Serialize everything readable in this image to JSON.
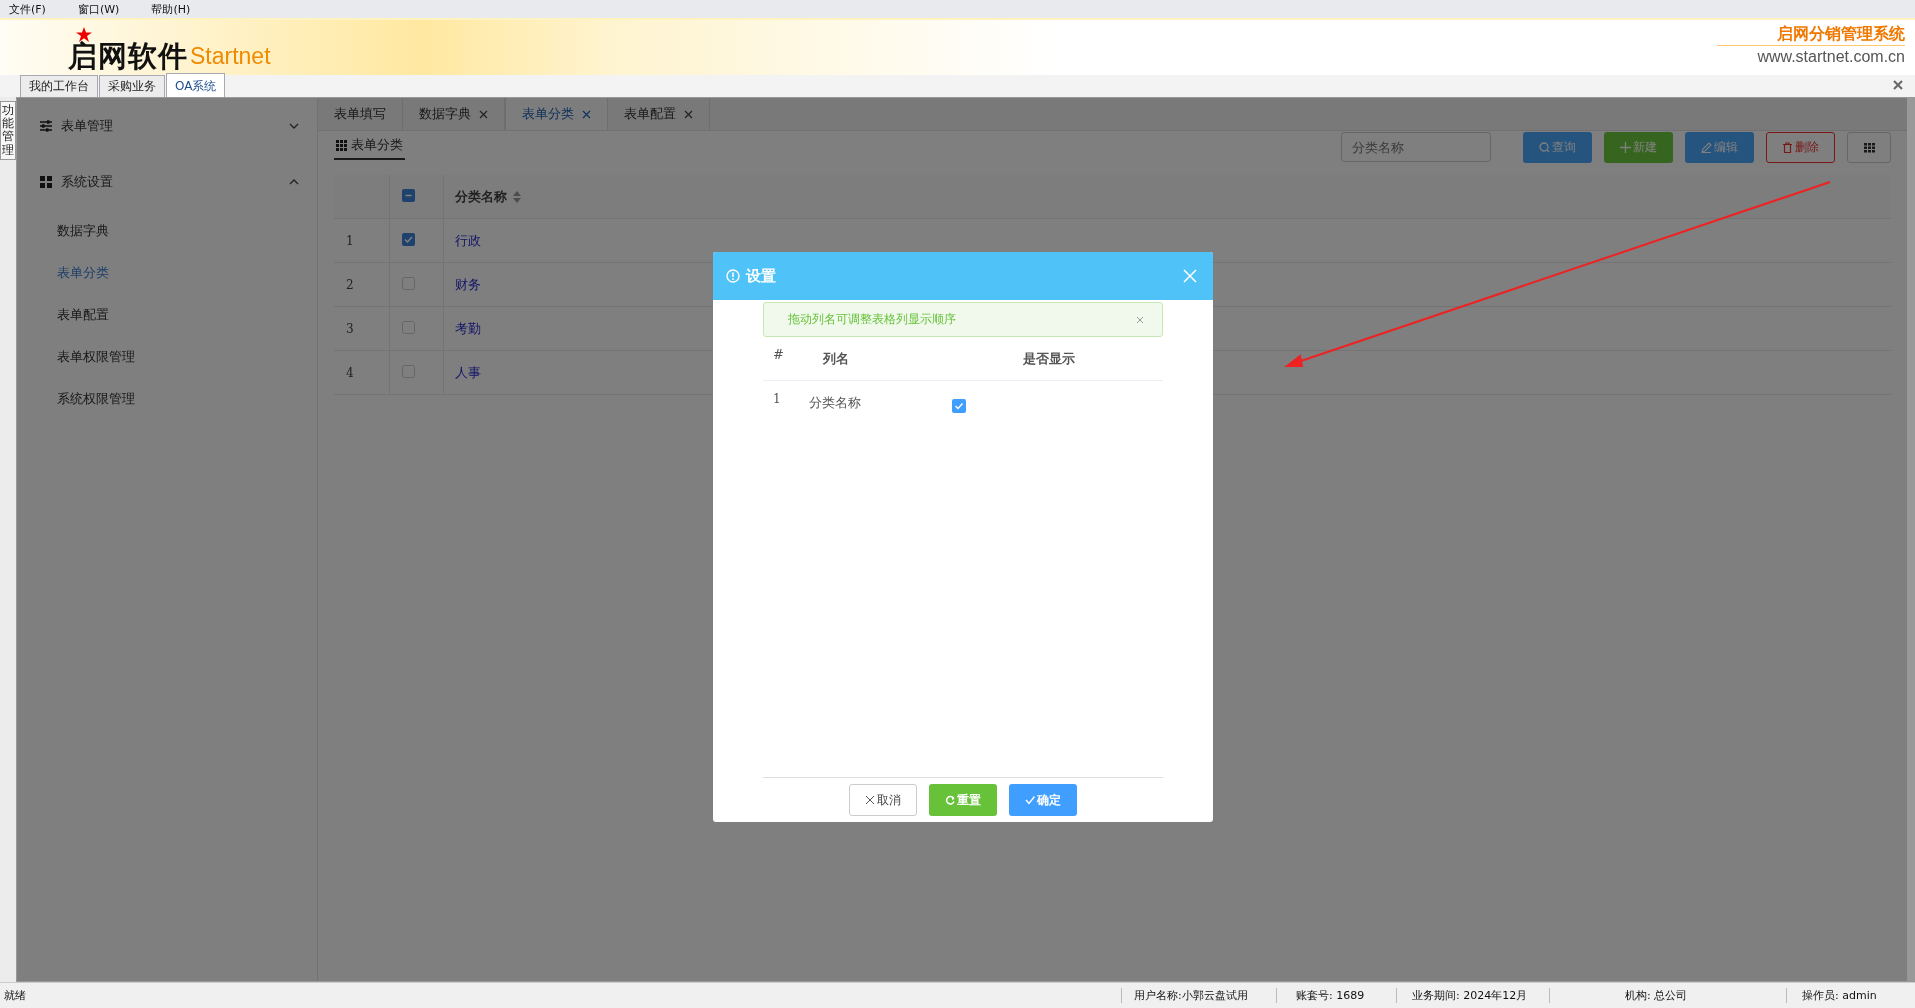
{
  "menu_bar": [
    "文件(F)",
    "窗口(W)",
    "帮助(H)"
  ],
  "header": {
    "logo_text": "启网软件",
    "logo_latin": "Startnet",
    "product_name": "启网分销管理系统",
    "website": "www.startnet.com.cn"
  },
  "side_tab": "功能管理",
  "module_tabs": [
    {
      "label": "我的工作台",
      "selected": false
    },
    {
      "label": "采购业务",
      "selected": false
    },
    {
      "label": "OA系统",
      "selected": true
    }
  ],
  "sidebar": {
    "groups": [
      {
        "label": "表单管理",
        "expanded": false
      },
      {
        "label": "系统设置",
        "expanded": true,
        "children": [
          {
            "label": "数据字典",
            "selected": false
          },
          {
            "label": "表单分类",
            "selected": true
          },
          {
            "label": "表单配置",
            "selected": false
          },
          {
            "label": "表单权限管理",
            "selected": false
          },
          {
            "label": "系统权限管理",
            "selected": false
          }
        ]
      }
    ]
  },
  "page_tabs": [
    {
      "label": "表单填写",
      "closable": false,
      "selected": false
    },
    {
      "label": "数据字典",
      "closable": true,
      "selected": false
    },
    {
      "label": "表单分类",
      "closable": true,
      "selected": true
    },
    {
      "label": "表单配置",
      "closable": true,
      "selected": false
    }
  ],
  "page_title": "表单分类",
  "toolbar": {
    "search": {
      "placeholder": "分类名称"
    },
    "buttons": [
      {
        "label": "查询",
        "kind": "primary"
      },
      {
        "label": "新建",
        "kind": "success"
      },
      {
        "label": "编辑",
        "kind": "primary"
      },
      {
        "label": "删除",
        "kind": "danger"
      },
      {
        "kind": "columns"
      }
    ]
  },
  "table": {
    "select_all_indeterminate": true,
    "columns": [
      {
        "label": "分类名称",
        "sortable": true
      }
    ],
    "rows": [
      {
        "index": "1",
        "checked": true,
        "name": "行政"
      },
      {
        "index": "2",
        "checked": false,
        "name": "财务"
      },
      {
        "index": "3",
        "checked": false,
        "name": "考勤"
      },
      {
        "index": "4",
        "checked": false,
        "name": "人事"
      }
    ]
  },
  "dialog": {
    "title": "设置",
    "alert": "拖动列名可调整表格列显示顺序",
    "columns": [
      "#",
      "列名",
      "是否显示"
    ],
    "rows": [
      {
        "index": "1",
        "name": "分类名称",
        "visible": true
      }
    ],
    "buttons": [
      {
        "label": "取消",
        "kind": "default"
      },
      {
        "label": "重置",
        "kind": "success"
      },
      {
        "label": "确定",
        "kind": "primary"
      }
    ]
  },
  "status_bar": {
    "status": "就绪",
    "fields": [
      "用户名称:小郭云盘试用",
      "账套号: 1689",
      "业务期间: 2024年12月",
      "机构: 总公司",
      "操作员: admin"
    ]
  }
}
